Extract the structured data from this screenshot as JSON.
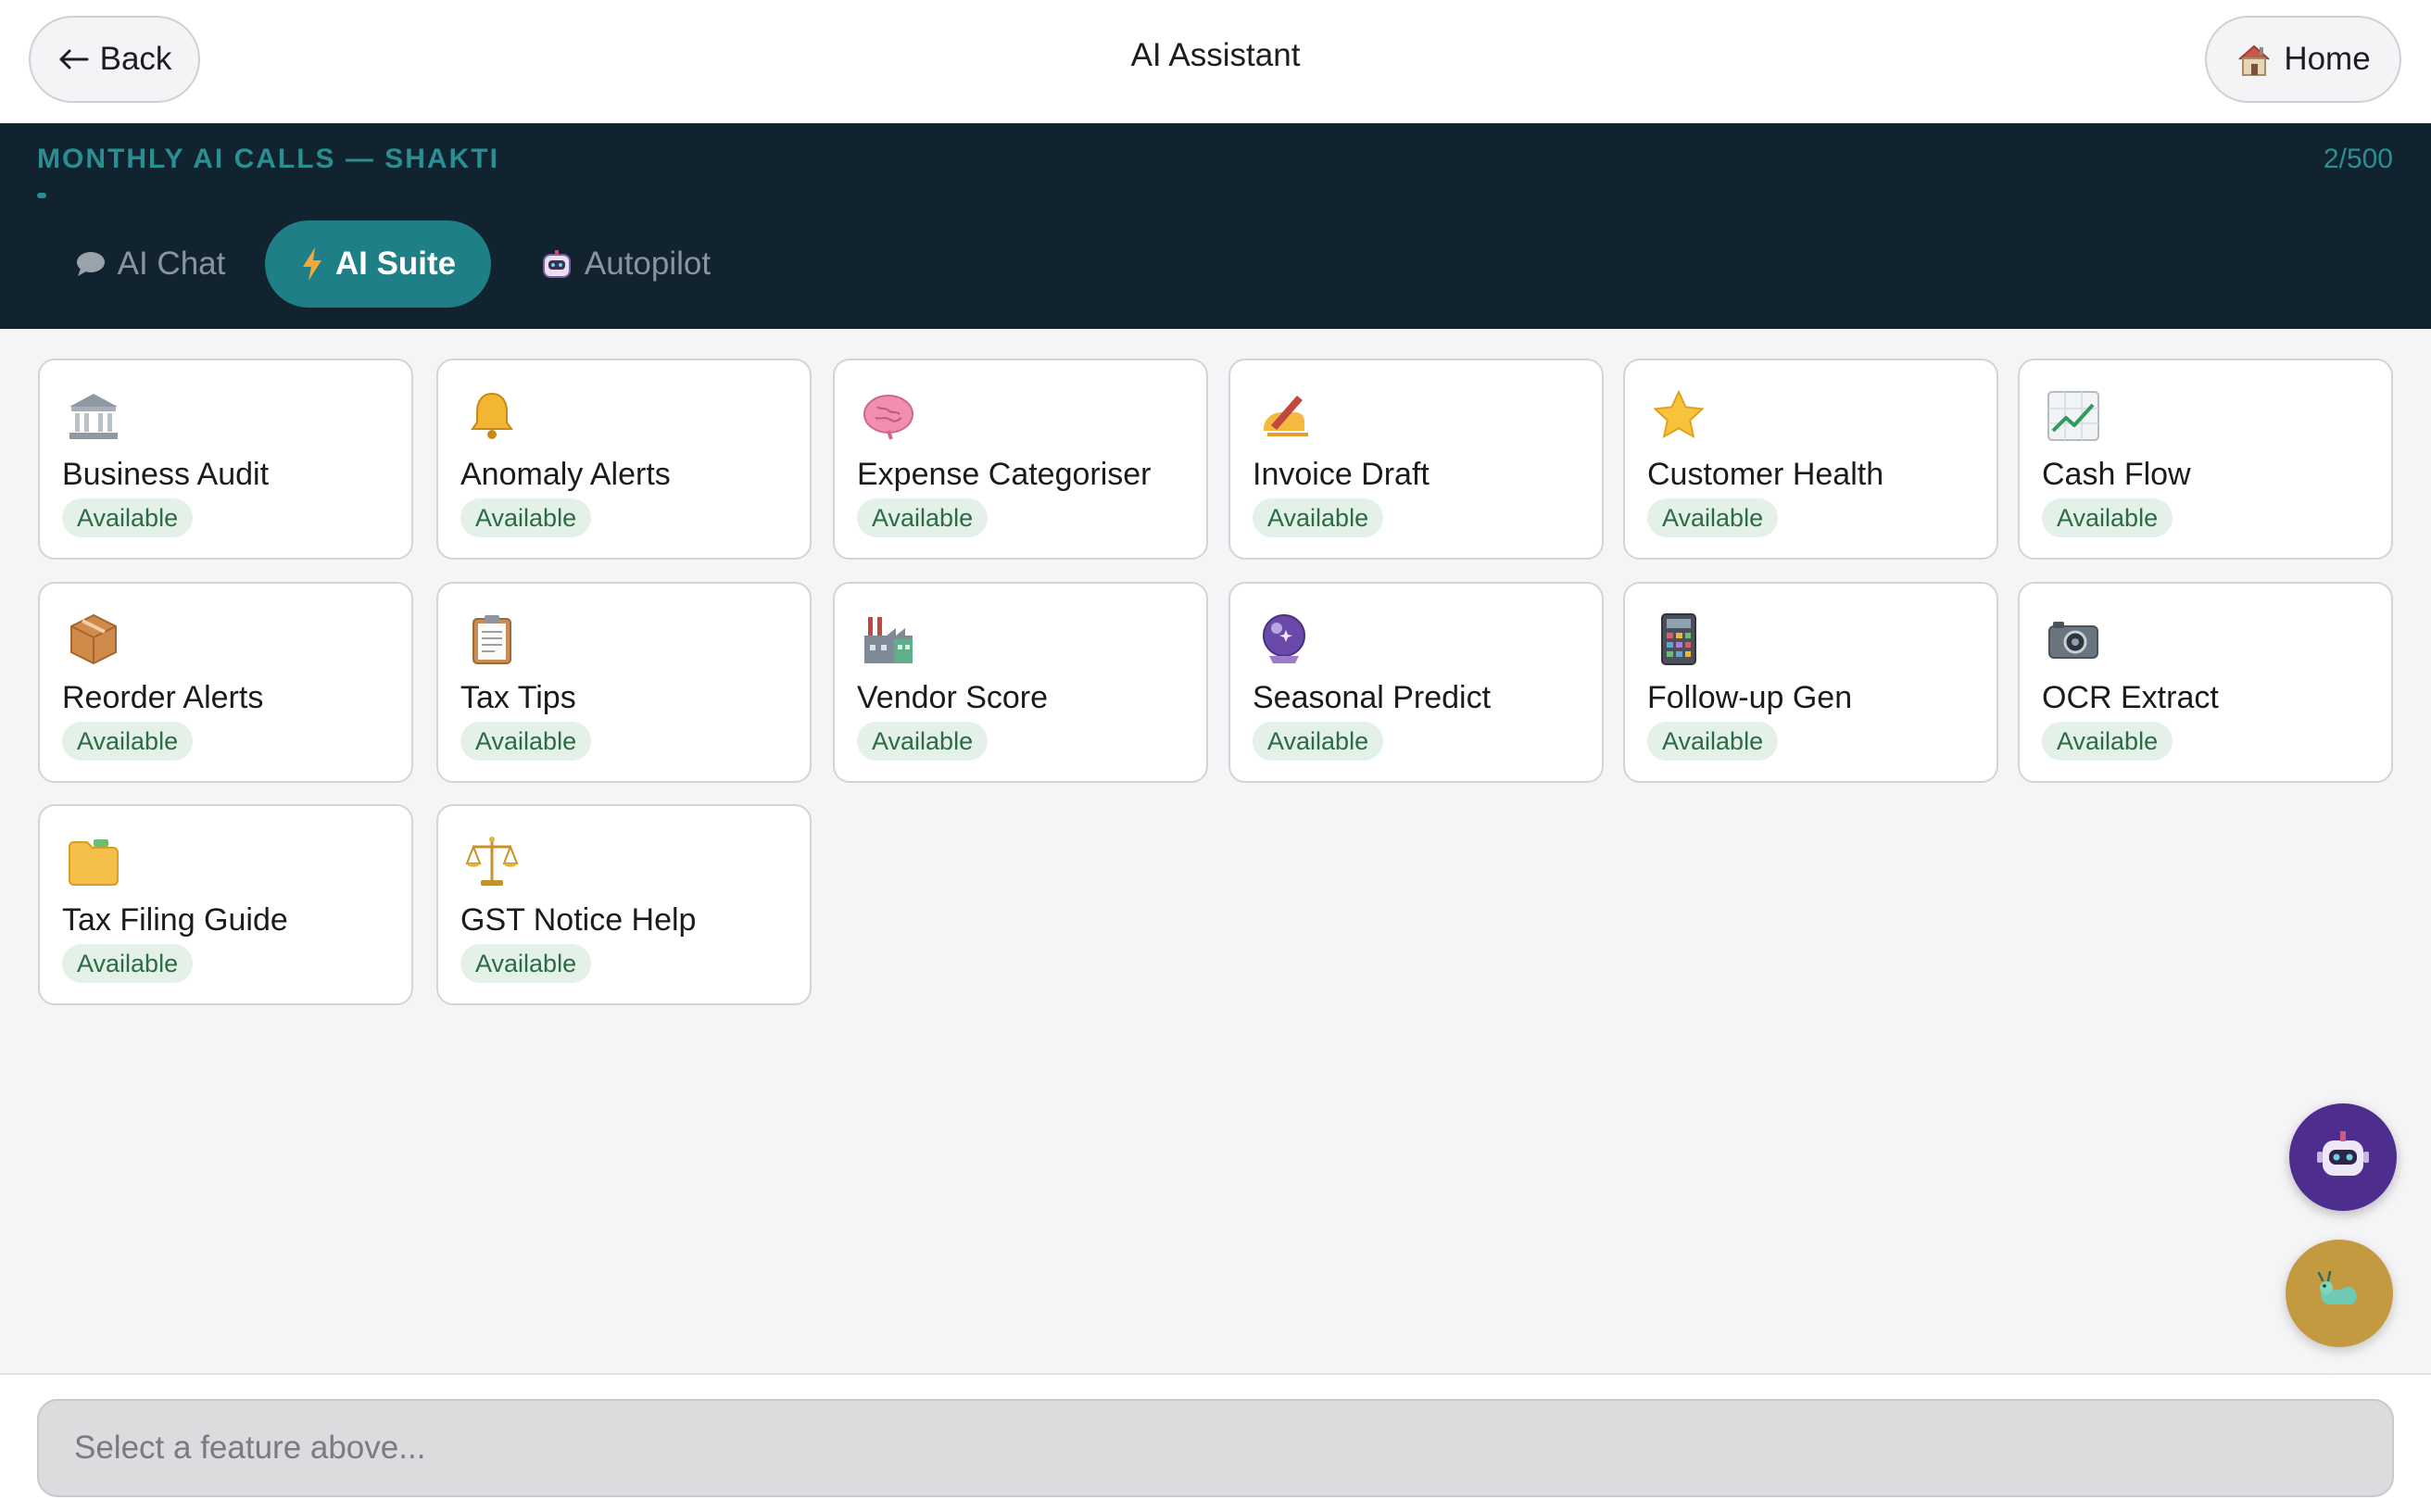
{
  "header": {
    "back_label": "Back",
    "title": "AI Assistant",
    "home_label": "Home"
  },
  "usage": {
    "label": "MONTHLY AI CALLS — SHAKTI",
    "count": "2/500",
    "used": 2,
    "limit": 500
  },
  "tabs": [
    {
      "label": "AI Chat",
      "icon": "speech-bubble-icon",
      "active": false
    },
    {
      "label": "AI Suite",
      "icon": "lightning-icon",
      "active": true
    },
    {
      "label": "Autopilot",
      "icon": "robot-icon",
      "active": false
    }
  ],
  "features": [
    {
      "name": "Business Audit",
      "status": "Available",
      "icon": "bank-icon"
    },
    {
      "name": "Anomaly Alerts",
      "status": "Available",
      "icon": "bell-icon"
    },
    {
      "name": "Expense Categoriser",
      "status": "Available",
      "icon": "brain-icon"
    },
    {
      "name": "Invoice Draft",
      "status": "Available",
      "icon": "writing-hand-icon"
    },
    {
      "name": "Customer Health",
      "status": "Available",
      "icon": "star-icon"
    },
    {
      "name": "Cash Flow",
      "status": "Available",
      "icon": "chart-up-icon"
    },
    {
      "name": "Reorder Alerts",
      "status": "Available",
      "icon": "package-icon"
    },
    {
      "name": "Tax Tips",
      "status": "Available",
      "icon": "clipboard-icon"
    },
    {
      "name": "Vendor Score",
      "status": "Available",
      "icon": "factory-icon"
    },
    {
      "name": "Seasonal Predict",
      "status": "Available",
      "icon": "crystal-ball-icon"
    },
    {
      "name": "Follow-up Gen",
      "status": "Available",
      "icon": "calculator-icon"
    },
    {
      "name": "OCR Extract",
      "status": "Available",
      "icon": "camera-icon"
    },
    {
      "name": "Tax Filing Guide",
      "status": "Available",
      "icon": "folder-icon"
    },
    {
      "name": "GST Notice Help",
      "status": "Available",
      "icon": "scales-icon"
    }
  ],
  "input": {
    "placeholder": "Select a feature above..."
  },
  "floating": {
    "robot": "robot-icon",
    "bug": "bug-icon"
  },
  "colors": {
    "header_bg": "#11232e",
    "accent": "#1f7f86",
    "badge_bg": "#e3f1e8",
    "badge_text": "#2c6b45"
  }
}
